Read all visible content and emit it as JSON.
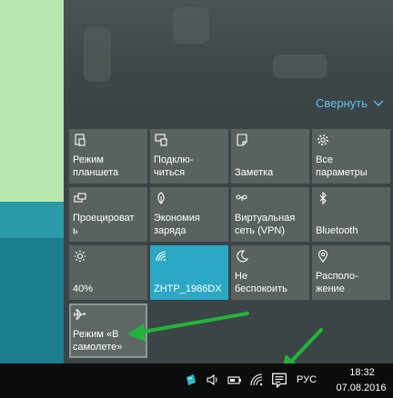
{
  "action_center": {
    "collapse_label": "Свернуть",
    "tiles": [
      {
        "label": "Режим\nпланшета",
        "icon": "tablet-mode-icon"
      },
      {
        "label": "Подклю-\nчиться",
        "icon": "connect-icon"
      },
      {
        "label": "Заметка",
        "icon": "note-icon"
      },
      {
        "label": "Все\nпараметры",
        "icon": "settings-gear-icon"
      },
      {
        "label": "Проецироват\nь",
        "icon": "project-icon"
      },
      {
        "label": "Экономия\nзаряда",
        "icon": "battery-saver-icon"
      },
      {
        "label": "Виртуальная\nсеть (VPN)",
        "icon": "vpn-icon"
      },
      {
        "label": "Bluetooth",
        "icon": "bluetooth-icon"
      },
      {
        "label": "40%",
        "icon": "brightness-icon"
      },
      {
        "label": "ZHTP_1986DX",
        "icon": "wifi-icon",
        "active": true
      },
      {
        "label": "Не\nбеспокоить",
        "icon": "quiet-hours-moon-icon"
      },
      {
        "label": "Располо-\nжение",
        "icon": "location-icon"
      },
      {
        "label": "Режим «В\nсамолете»",
        "icon": "airplane-icon",
        "highlighted": true
      }
    ]
  },
  "taskbar": {
    "language": "РУС",
    "time": "18:32",
    "date": "07.08.2016"
  },
  "colors": {
    "accent": "#5cc4e8",
    "active_tile": "#2aa8c4",
    "tile": "#59625f",
    "arrow": "#22b43a"
  }
}
